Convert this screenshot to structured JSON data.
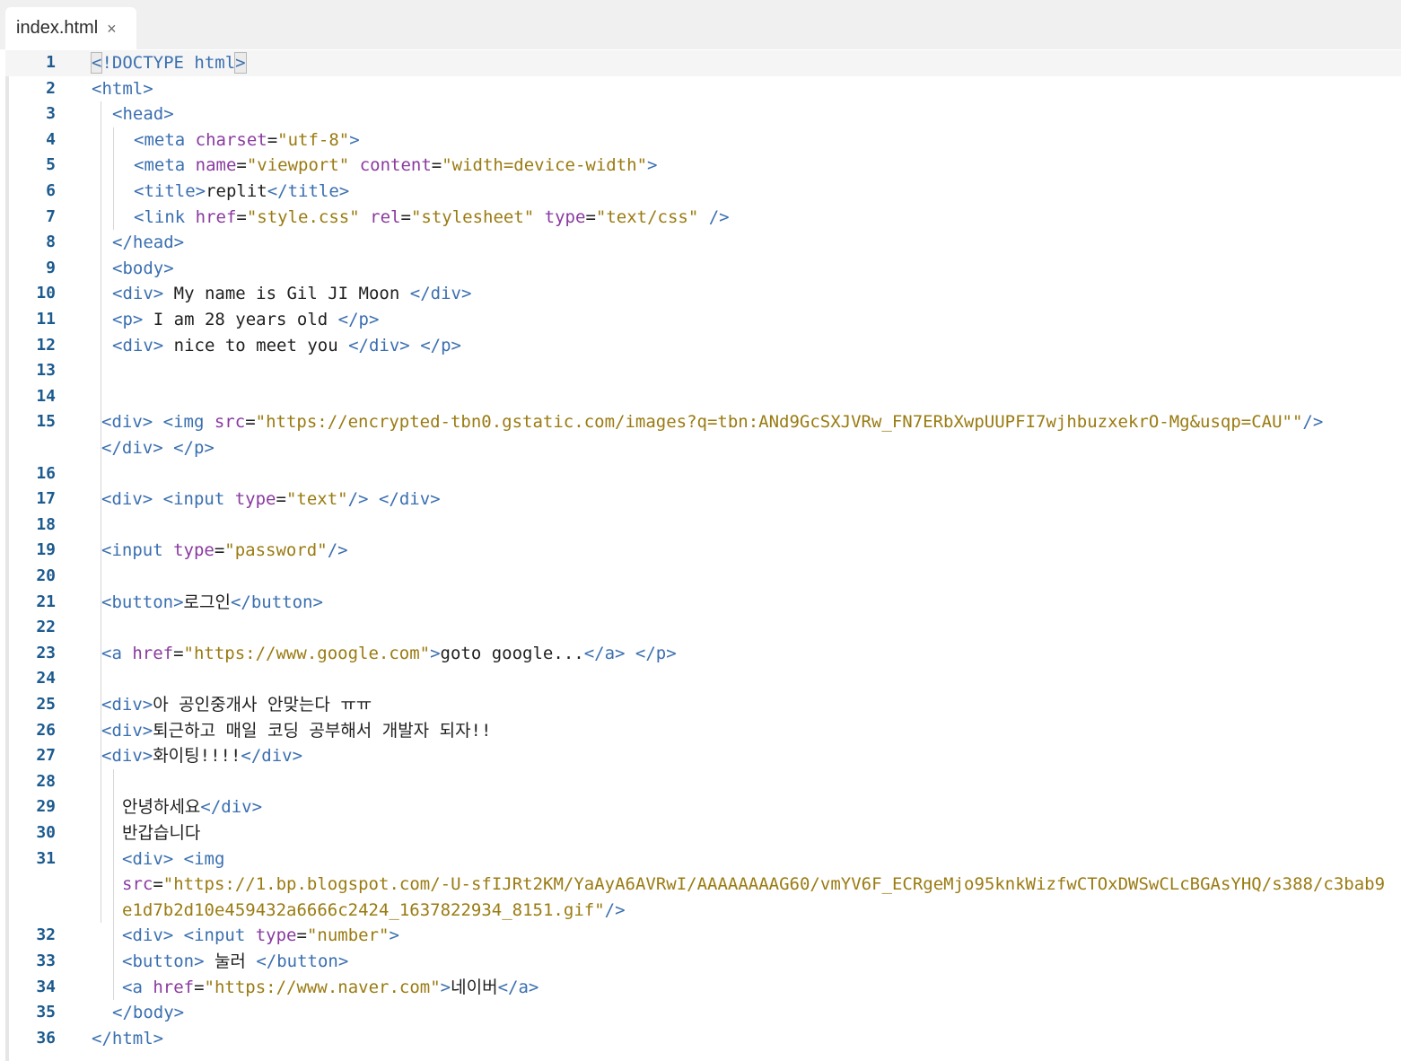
{
  "tab": {
    "label": "index.html",
    "close_glyph": "×"
  },
  "lines": [
    {
      "n": "1",
      "indent": 96,
      "current": true,
      "parts": [
        [
          "bb",
          "<"
        ],
        [
          "tag",
          "!DOCTYPE "
        ],
        [
          "tag",
          "html"
        ],
        [
          "bb",
          ">"
        ]
      ]
    },
    {
      "n": "2",
      "indent": 96,
      "parts": [
        [
          "tag",
          "<html>"
        ]
      ]
    },
    {
      "n": "3",
      "indent": 119,
      "parts": [
        [
          "tag",
          "<head>"
        ]
      ]
    },
    {
      "n": "4",
      "indent": 143,
      "parts": [
        [
          "tag",
          "<meta "
        ],
        [
          "attr",
          "charset"
        ],
        [
          "txt",
          "="
        ],
        [
          "str",
          "\"utf-8\""
        ],
        [
          "tag",
          ">"
        ]
      ]
    },
    {
      "n": "5",
      "indent": 143,
      "parts": [
        [
          "tag",
          "<meta "
        ],
        [
          "attr",
          "name"
        ],
        [
          "txt",
          "="
        ],
        [
          "str",
          "\"viewport\""
        ],
        [
          "txt",
          " "
        ],
        [
          "attr",
          "content"
        ],
        [
          "txt",
          "="
        ],
        [
          "str",
          "\"width=device-width\""
        ],
        [
          "tag",
          ">"
        ]
      ]
    },
    {
      "n": "6",
      "indent": 143,
      "parts": [
        [
          "tag",
          "<title>"
        ],
        [
          "txt",
          "replit"
        ],
        [
          "tag",
          "</title>"
        ]
      ]
    },
    {
      "n": "7",
      "indent": 143,
      "parts": [
        [
          "tag",
          "<link "
        ],
        [
          "attr",
          "href"
        ],
        [
          "txt",
          "="
        ],
        [
          "str",
          "\"style.css\""
        ],
        [
          "txt",
          " "
        ],
        [
          "attr",
          "rel"
        ],
        [
          "txt",
          "="
        ],
        [
          "str",
          "\"stylesheet\""
        ],
        [
          "txt",
          " "
        ],
        [
          "attr",
          "type"
        ],
        [
          "txt",
          "="
        ],
        [
          "str",
          "\"text/css\""
        ],
        [
          "tag",
          " />"
        ]
      ]
    },
    {
      "n": "8",
      "indent": 119,
      "parts": [
        [
          "tag",
          "</head>"
        ]
      ]
    },
    {
      "n": "9",
      "indent": 119,
      "parts": [
        [
          "tag",
          "<body>"
        ]
      ]
    },
    {
      "n": "10",
      "indent": 119,
      "parts": [
        [
          "tag",
          "<div>"
        ],
        [
          "txt",
          " My name is Gil JI Moon "
        ],
        [
          "tag",
          "</div>"
        ]
      ]
    },
    {
      "n": "11",
      "indent": 119,
      "parts": [
        [
          "tag",
          "<p>"
        ],
        [
          "txt",
          " I am 28 years old "
        ],
        [
          "tag",
          "</p>"
        ]
      ]
    },
    {
      "n": "12",
      "indent": 119,
      "parts": [
        [
          "tag",
          "<div>"
        ],
        [
          "txt",
          " nice to meet you "
        ],
        [
          "tag",
          "</div>"
        ],
        [
          "txt",
          " "
        ],
        [
          "tag",
          "</p>"
        ]
      ]
    },
    {
      "n": "13",
      "indent": 107,
      "parts": []
    },
    {
      "n": "14",
      "indent": 107,
      "parts": []
    },
    {
      "n": "15",
      "indent": 107,
      "parts": [
        [
          "tag",
          "<div>"
        ],
        [
          "txt",
          " "
        ],
        [
          "tag",
          "<img "
        ],
        [
          "attr",
          "src"
        ],
        [
          "txt",
          "="
        ],
        [
          "str",
          "\"https://encrypted-tbn0.gstatic.com/images?q=tbn:ANd9GcSXJVRw_FN7ERbXwpUUPFI7wjhbuzxekrO-Mg&usqp=CAU\"\""
        ],
        [
          "tag",
          "/>"
        ]
      ]
    },
    {
      "n": "",
      "indent": 107,
      "parts": [
        [
          "tag",
          "</div>"
        ],
        [
          "txt",
          " "
        ],
        [
          "tag",
          "</p>"
        ]
      ]
    },
    {
      "n": "16",
      "indent": 107,
      "parts": []
    },
    {
      "n": "17",
      "indent": 107,
      "parts": [
        [
          "tag",
          "<div>"
        ],
        [
          "txt",
          " "
        ],
        [
          "tag",
          "<input "
        ],
        [
          "attr",
          "type"
        ],
        [
          "txt",
          "="
        ],
        [
          "str",
          "\"text\""
        ],
        [
          "tag",
          "/>"
        ],
        [
          "txt",
          " "
        ],
        [
          "tag",
          "</div>"
        ]
      ]
    },
    {
      "n": "18",
      "indent": 107,
      "parts": []
    },
    {
      "n": "19",
      "indent": 107,
      "parts": [
        [
          "tag",
          "<input "
        ],
        [
          "attr",
          "type"
        ],
        [
          "txt",
          "="
        ],
        [
          "str",
          "\"password\""
        ],
        [
          "tag",
          "/>"
        ]
      ]
    },
    {
      "n": "20",
      "indent": 107,
      "parts": []
    },
    {
      "n": "21",
      "indent": 107,
      "parts": [
        [
          "tag",
          "<button>"
        ],
        [
          "txt",
          "로그인"
        ],
        [
          "tag",
          "</button>"
        ]
      ]
    },
    {
      "n": "22",
      "indent": 107,
      "parts": []
    },
    {
      "n": "23",
      "indent": 107,
      "parts": [
        [
          "tag",
          "<a "
        ],
        [
          "attr",
          "href"
        ],
        [
          "txt",
          "="
        ],
        [
          "str",
          "\"https://www.google.com\""
        ],
        [
          "tag",
          ">"
        ],
        [
          "txt",
          "goto google..."
        ],
        [
          "tag",
          "</a>"
        ],
        [
          "txt",
          " "
        ],
        [
          "tag",
          "</p>"
        ]
      ]
    },
    {
      "n": "24",
      "indent": 107,
      "parts": []
    },
    {
      "n": "25",
      "indent": 107,
      "parts": [
        [
          "tag",
          "<div>"
        ],
        [
          "txt",
          "아 공인중개사 안맞는다 ㅠㅠ"
        ]
      ]
    },
    {
      "n": "26",
      "indent": 107,
      "parts": [
        [
          "tag",
          "<div>"
        ],
        [
          "txt",
          "퇴근하고 매일 코딩 공부해서 개발자 되자!!"
        ]
      ]
    },
    {
      "n": "27",
      "indent": 107,
      "parts": [
        [
          "tag",
          "<div>"
        ],
        [
          "txt",
          "화이팅!!!!"
        ],
        [
          "tag",
          "</div>"
        ]
      ]
    },
    {
      "n": "28",
      "indent": 107,
      "parts": []
    },
    {
      "n": "29",
      "indent": 130,
      "parts": [
        [
          "txt",
          "안녕하세요"
        ],
        [
          "tag",
          "</div>"
        ]
      ]
    },
    {
      "n": "30",
      "indent": 130,
      "parts": [
        [
          "txt",
          "반갑습니다"
        ]
      ]
    },
    {
      "n": "31",
      "indent": 130,
      "parts": [
        [
          "tag",
          "<div>"
        ],
        [
          "txt",
          " "
        ],
        [
          "tag",
          "<img"
        ]
      ]
    },
    {
      "n": "",
      "indent": 130,
      "parts": [
        [
          "attr",
          "src"
        ],
        [
          "txt",
          "="
        ],
        [
          "str",
          "\"https://1.bp.blogspot.com/-U-sfIJRt2KM/YaAyA6AVRwI/AAAAAAAAG60/vmYV6F_ECRgeMjo95knkWizfwCTOxDWSwCLcBGAsYHQ/s388/c3bab9"
        ]
      ]
    },
    {
      "n": "",
      "indent": 130,
      "parts": [
        [
          "str",
          "e1d7b2d10e459432a6666c2424_1637822934_8151.gif\""
        ],
        [
          "tag",
          "/>"
        ]
      ]
    },
    {
      "n": "32",
      "indent": 130,
      "parts": [
        [
          "tag",
          "<div>"
        ],
        [
          "txt",
          " "
        ],
        [
          "tag",
          "<input "
        ],
        [
          "attr",
          "type"
        ],
        [
          "txt",
          "="
        ],
        [
          "str",
          "\"number\""
        ],
        [
          "tag",
          ">"
        ]
      ]
    },
    {
      "n": "33",
      "indent": 130,
      "parts": [
        [
          "tag",
          "<button>"
        ],
        [
          "txt",
          " 눌러 "
        ],
        [
          "tag",
          "</button>"
        ]
      ]
    },
    {
      "n": "34",
      "indent": 130,
      "parts": [
        [
          "tag",
          "<a "
        ],
        [
          "attr",
          "href"
        ],
        [
          "txt",
          "="
        ],
        [
          "str",
          "\"https://www.naver.com\""
        ],
        [
          "tag",
          ">"
        ],
        [
          "txt",
          "네이버"
        ],
        [
          "tag",
          "</a>"
        ]
      ]
    },
    {
      "n": "35",
      "indent": 119,
      "parts": [
        [
          "tag",
          "</body>"
        ]
      ]
    },
    {
      "n": "36",
      "indent": 96,
      "parts": [
        [
          "tag",
          "</html>"
        ]
      ]
    }
  ]
}
